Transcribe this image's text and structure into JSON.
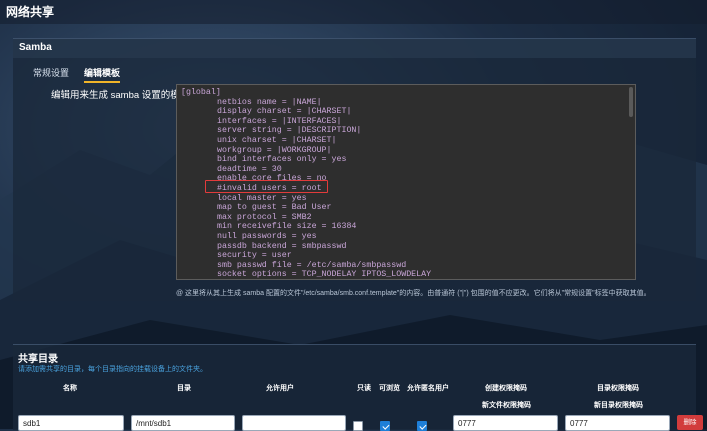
{
  "window": {
    "title": "网络共享"
  },
  "panel": {
    "title": "Samba",
    "tabs": [
      {
        "label": "常规设置"
      },
      {
        "label": "编辑模板"
      }
    ],
    "template_label": "编辑用来生成 samba 设置的模板",
    "template_lines": [
      "[global]",
      "netbios name = |NAME|",
      "display charset = |CHARSET|",
      "interfaces = |INTERFACES|",
      "server string = |DESCRIPTION|",
      "unix charset = |CHARSET|",
      "workgroup = |WORKGROUP|",
      "bind interfaces only = yes",
      "deadtime = 30",
      "enable core files = no",
      "#invalid users = root",
      "local master = yes",
      "map to guest = Bad User",
      "max protocol = SMB2",
      "min receivefile size = 16384",
      "null passwords = yes",
      "passdb backend = smbpasswd",
      "security = user",
      "smb passwd file = /etc/samba/smbpasswd",
      "socket options = TCP_NODELAY IPTOS_LOWDELAY"
    ],
    "hint": "@ 这里将从其上生成 samba 配置的文件\"/etc/samba/smb.conf.template\"的内容。由普通符 (\"|\") 包围的值不应更改。它们将从\"常规设置\"标签中获取其值。"
  },
  "share": {
    "title": "共享目录",
    "description": "请添加需共享的目录，每个目录指向的挂载设备上的文件夹。",
    "columns": {
      "name": "名称",
      "path": "目录",
      "users": "允许用户",
      "readonly": "只读",
      "browseable": "可浏览",
      "guest": "允许匿名用户",
      "create_mask": "创建权限掩码",
      "create_mask_sub": "新文件权限掩码",
      "dir_mask": "目录权限掩码",
      "dir_mask_sub": "新目录权限掩码"
    },
    "rows": [
      {
        "name": "sdb1",
        "path": "/mnt/sdb1",
        "users": "",
        "readonly": false,
        "browseable": true,
        "guest": true,
        "create_mask": "0777",
        "dir_mask": "0777",
        "delete_label": "删除"
      }
    ]
  },
  "colors": {
    "accent": "#f0b429",
    "danger": "#d23c3c",
    "link": "#4aa3df",
    "check": "#1e7fd8"
  }
}
